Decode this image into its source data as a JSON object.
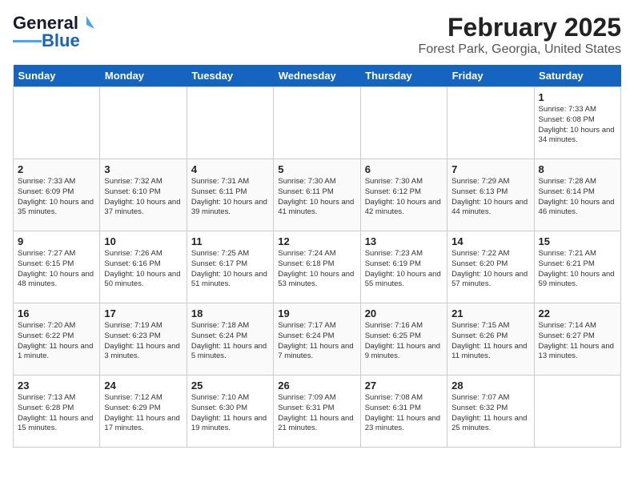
{
  "app": {
    "logo_line1": "General",
    "logo_line2": "Blue"
  },
  "header": {
    "title": "February 2025",
    "subtitle": "Forest Park, Georgia, United States"
  },
  "weekdays": [
    "Sunday",
    "Monday",
    "Tuesday",
    "Wednesday",
    "Thursday",
    "Friday",
    "Saturday"
  ],
  "weeks": [
    [
      {
        "day": "",
        "info": ""
      },
      {
        "day": "",
        "info": ""
      },
      {
        "day": "",
        "info": ""
      },
      {
        "day": "",
        "info": ""
      },
      {
        "day": "",
        "info": ""
      },
      {
        "day": "",
        "info": ""
      },
      {
        "day": "1",
        "info": "Sunrise: 7:33 AM\nSunset: 6:08 PM\nDaylight: 10 hours and 34 minutes."
      }
    ],
    [
      {
        "day": "2",
        "info": "Sunrise: 7:33 AM\nSunset: 6:09 PM\nDaylight: 10 hours and 35 minutes."
      },
      {
        "day": "3",
        "info": "Sunrise: 7:32 AM\nSunset: 6:10 PM\nDaylight: 10 hours and 37 minutes."
      },
      {
        "day": "4",
        "info": "Sunrise: 7:31 AM\nSunset: 6:11 PM\nDaylight: 10 hours and 39 minutes."
      },
      {
        "day": "5",
        "info": "Sunrise: 7:30 AM\nSunset: 6:11 PM\nDaylight: 10 hours and 41 minutes."
      },
      {
        "day": "6",
        "info": "Sunrise: 7:30 AM\nSunset: 6:12 PM\nDaylight: 10 hours and 42 minutes."
      },
      {
        "day": "7",
        "info": "Sunrise: 7:29 AM\nSunset: 6:13 PM\nDaylight: 10 hours and 44 minutes."
      },
      {
        "day": "8",
        "info": "Sunrise: 7:28 AM\nSunset: 6:14 PM\nDaylight: 10 hours and 46 minutes."
      }
    ],
    [
      {
        "day": "9",
        "info": "Sunrise: 7:27 AM\nSunset: 6:15 PM\nDaylight: 10 hours and 48 minutes."
      },
      {
        "day": "10",
        "info": "Sunrise: 7:26 AM\nSunset: 6:16 PM\nDaylight: 10 hours and 50 minutes."
      },
      {
        "day": "11",
        "info": "Sunrise: 7:25 AM\nSunset: 6:17 PM\nDaylight: 10 hours and 51 minutes."
      },
      {
        "day": "12",
        "info": "Sunrise: 7:24 AM\nSunset: 6:18 PM\nDaylight: 10 hours and 53 minutes."
      },
      {
        "day": "13",
        "info": "Sunrise: 7:23 AM\nSunset: 6:19 PM\nDaylight: 10 hours and 55 minutes."
      },
      {
        "day": "14",
        "info": "Sunrise: 7:22 AM\nSunset: 6:20 PM\nDaylight: 10 hours and 57 minutes."
      },
      {
        "day": "15",
        "info": "Sunrise: 7:21 AM\nSunset: 6:21 PM\nDaylight: 10 hours and 59 minutes."
      }
    ],
    [
      {
        "day": "16",
        "info": "Sunrise: 7:20 AM\nSunset: 6:22 PM\nDaylight: 11 hours and 1 minute."
      },
      {
        "day": "17",
        "info": "Sunrise: 7:19 AM\nSunset: 6:23 PM\nDaylight: 11 hours and 3 minutes."
      },
      {
        "day": "18",
        "info": "Sunrise: 7:18 AM\nSunset: 6:24 PM\nDaylight: 11 hours and 5 minutes."
      },
      {
        "day": "19",
        "info": "Sunrise: 7:17 AM\nSunset: 6:24 PM\nDaylight: 11 hours and 7 minutes."
      },
      {
        "day": "20",
        "info": "Sunrise: 7:16 AM\nSunset: 6:25 PM\nDaylight: 11 hours and 9 minutes."
      },
      {
        "day": "21",
        "info": "Sunrise: 7:15 AM\nSunset: 6:26 PM\nDaylight: 11 hours and 11 minutes."
      },
      {
        "day": "22",
        "info": "Sunrise: 7:14 AM\nSunset: 6:27 PM\nDaylight: 11 hours and 13 minutes."
      }
    ],
    [
      {
        "day": "23",
        "info": "Sunrise: 7:13 AM\nSunset: 6:28 PM\nDaylight: 11 hours and 15 minutes."
      },
      {
        "day": "24",
        "info": "Sunrise: 7:12 AM\nSunset: 6:29 PM\nDaylight: 11 hours and 17 minutes."
      },
      {
        "day": "25",
        "info": "Sunrise: 7:10 AM\nSunset: 6:30 PM\nDaylight: 11 hours and 19 minutes."
      },
      {
        "day": "26",
        "info": "Sunrise: 7:09 AM\nSunset: 6:31 PM\nDaylight: 11 hours and 21 minutes."
      },
      {
        "day": "27",
        "info": "Sunrise: 7:08 AM\nSunset: 6:31 PM\nDaylight: 11 hours and 23 minutes."
      },
      {
        "day": "28",
        "info": "Sunrise: 7:07 AM\nSunset: 6:32 PM\nDaylight: 11 hours and 25 minutes."
      },
      {
        "day": "",
        "info": ""
      }
    ]
  ]
}
